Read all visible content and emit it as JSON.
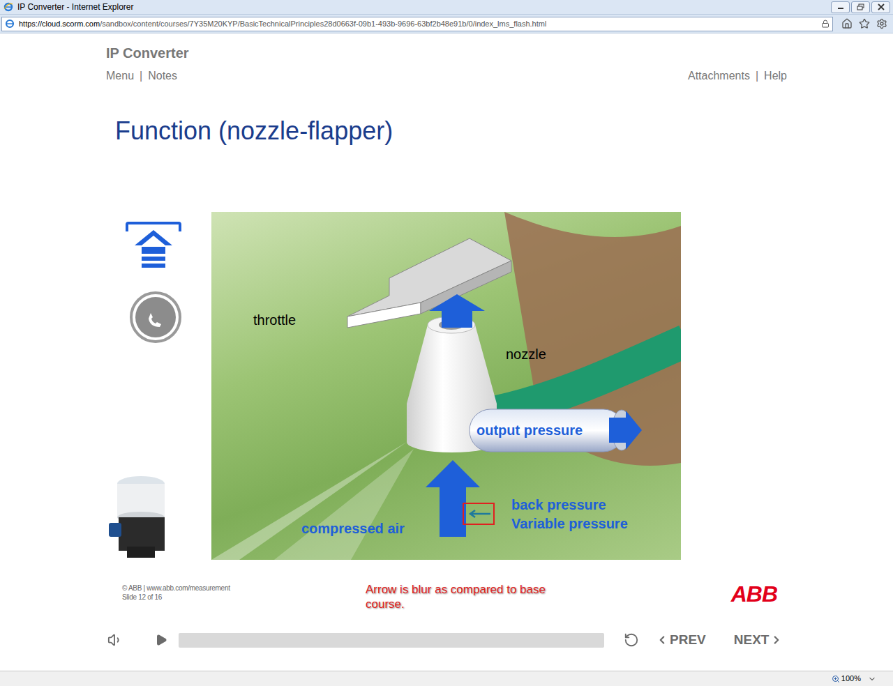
{
  "window": {
    "title": "IP Converter - Internet Explorer"
  },
  "address_bar": {
    "url_host": "https://cloud.scorm.com",
    "url_path": "/sandbox/content/courses/7Y35M20KYP/BasicTechnicalPrinciples28d0663f-09b1-493b-9696-63bf2b48e91b/0/index_lms_flash.html"
  },
  "course": {
    "title": "IP Converter",
    "nav_left": [
      "Menu",
      "Notes"
    ],
    "nav_right": [
      "Attachments",
      "Help"
    ],
    "separator": "|"
  },
  "slide": {
    "title": "Function (nozzle-flapper)",
    "diagram": {
      "throttle": "throttle",
      "nozzle": "nozzle",
      "output": "output pressure",
      "input": "compressed air",
      "back_pressure": [
        "back pressure",
        "Variable pressure"
      ]
    },
    "copyright": "© ABB | www.abb.com/measurement",
    "slide_number": "Slide 12 of 16",
    "logo": "ABB"
  },
  "annotation": "Arrow is blur as compared to base course.",
  "player": {
    "level": 0,
    "prev": "PREV",
    "next": "NEXT"
  },
  "status_bar": {
    "zoom": "100%"
  }
}
